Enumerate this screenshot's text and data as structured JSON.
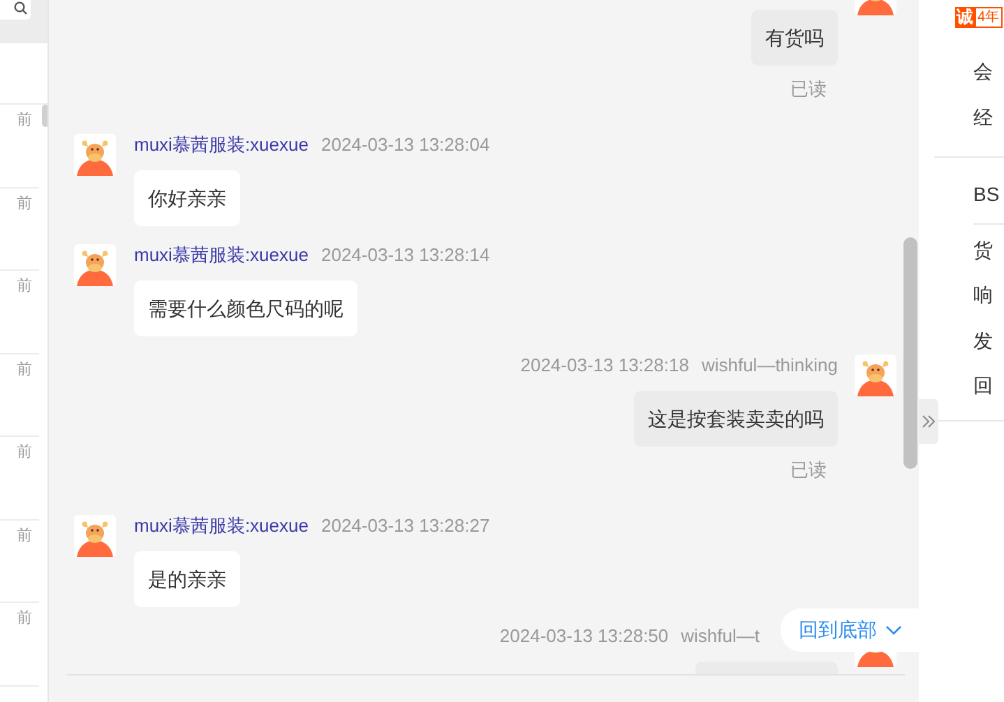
{
  "conversation_list": {
    "items": [
      {
        "time": "前"
      },
      {
        "time": "前"
      },
      {
        "time": "前"
      },
      {
        "time": "前"
      },
      {
        "time": "前"
      },
      {
        "time": "前"
      },
      {
        "time": "前"
      }
    ]
  },
  "messages": [
    {
      "kind": "sent",
      "text": "有货吗",
      "read_status": "已读"
    },
    {
      "kind": "received",
      "sender": "muxi慕茜服装:xuexue",
      "time": "2024-03-13 13:28:04",
      "text": "你好亲亲"
    },
    {
      "kind": "received",
      "sender": "muxi慕茜服装:xuexue",
      "time": "2024-03-13 13:28:14",
      "text": "需要什么颜色尺码的呢"
    },
    {
      "kind": "sent",
      "sender": "wishful—thinking",
      "time": "2024-03-13 13:28:18",
      "text": "这是按套装卖卖的吗",
      "read_status": "已读"
    },
    {
      "kind": "received",
      "sender": "muxi慕茜服装:xuexue",
      "time": "2024-03-13 13:28:27",
      "text": "是的亲亲"
    },
    {
      "kind": "sent",
      "sender": "wishful—t",
      "time": "2024-03-13 13:28:50"
    }
  ],
  "scroll_to_bottom_button": {
    "label": "回到底部"
  },
  "side_panel": {
    "badge": "诚",
    "badge_years": "4年",
    "groups": [
      [
        "会",
        "经"
      ],
      [
        "BS"
      ],
      [
        "货",
        "响",
        "发",
        "回"
      ]
    ]
  }
}
